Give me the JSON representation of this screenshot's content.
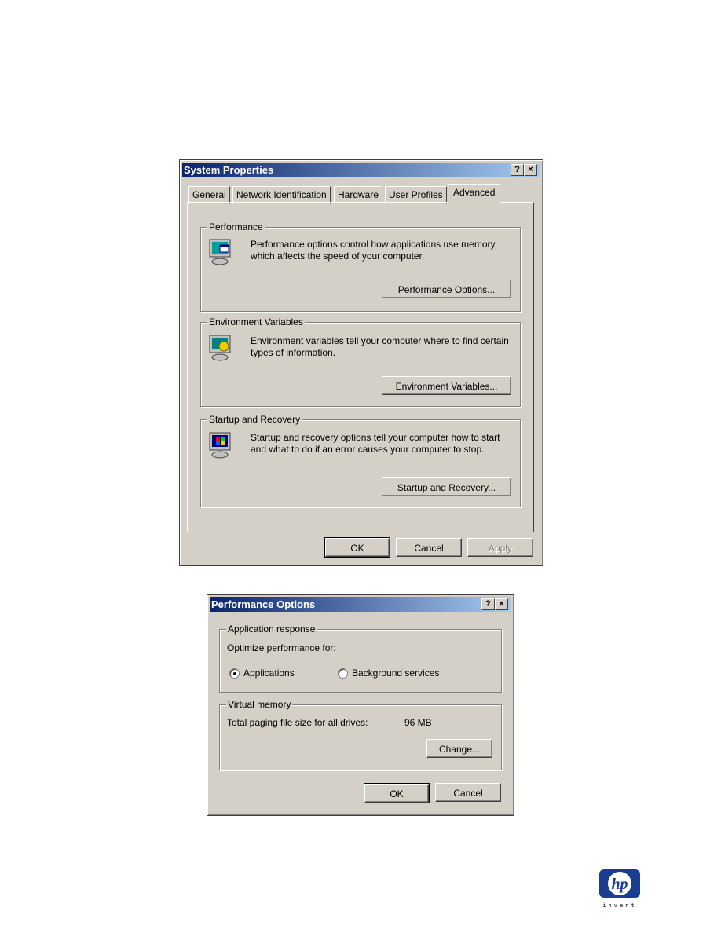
{
  "system_properties": {
    "title": "System Properties",
    "help_label": "?",
    "close_label": "×",
    "tabs": [
      {
        "label": "General"
      },
      {
        "label": "Network Identification"
      },
      {
        "label": "Hardware"
      },
      {
        "label": "User Profiles"
      },
      {
        "label": "Advanced",
        "active": true
      }
    ],
    "groups": [
      {
        "label": "Performance",
        "text": "Performance options control how applications use memory, which affects the speed of your computer.",
        "button": "Performance Options...",
        "icon": "performance-monitor-icon"
      },
      {
        "label": "Environment Variables",
        "text": "Environment variables tell your computer where to find certain types of information.",
        "button": "Environment Variables...",
        "icon": "environment-monitor-icon"
      },
      {
        "label": "Startup and Recovery",
        "text": "Startup and recovery options tell your computer how to start and what to do if an error causes your computer to stop.",
        "button": "Startup and Recovery...",
        "icon": "startup-monitor-icon"
      }
    ],
    "ok": "OK",
    "cancel": "Cancel",
    "apply": "Apply"
  },
  "performance_options": {
    "title": "Performance Options",
    "help_label": "?",
    "close_label": "×",
    "app_response": {
      "label": "Application response",
      "prompt": "Optimize performance for:",
      "options": [
        {
          "label": "Applications",
          "selected": true
        },
        {
          "label": "Background services",
          "selected": false
        }
      ]
    },
    "virtual_memory": {
      "label": "Virtual memory",
      "text": "Total paging file size for all drives:",
      "value": "96 MB",
      "button": "Change..."
    },
    "ok": "OK",
    "cancel": "Cancel"
  },
  "logo": {
    "brand": "hp",
    "tagline": "invent",
    "color": "#1a3d8f"
  }
}
